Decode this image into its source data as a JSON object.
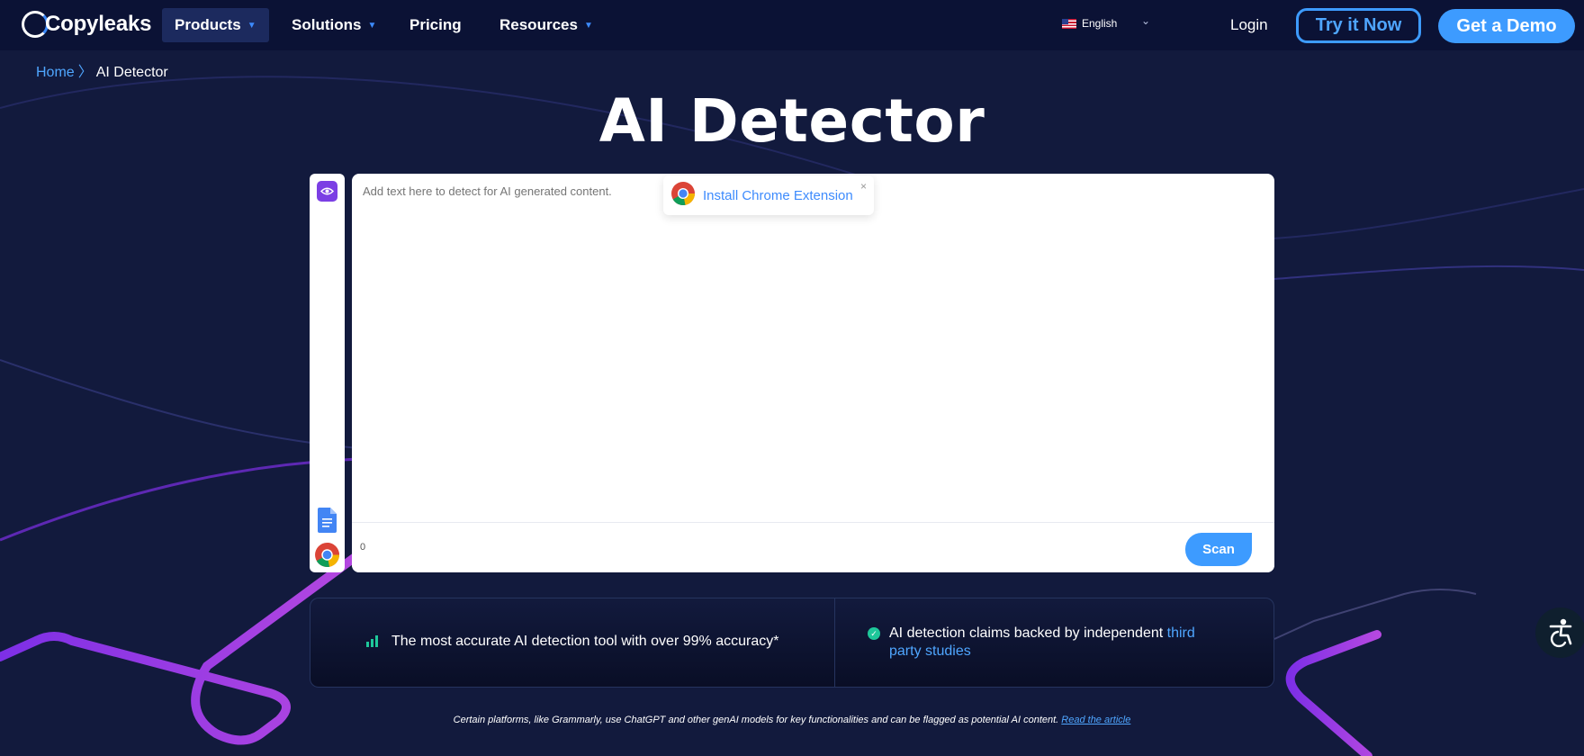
{
  "nav": {
    "logo_text": "Copyleaks",
    "logo_letter": "C",
    "items": [
      {
        "label": "Products",
        "has_caret": true,
        "active": true
      },
      {
        "label": "Solutions",
        "has_caret": true,
        "active": false
      },
      {
        "label": "Pricing",
        "has_caret": false,
        "active": false
      },
      {
        "label": "Resources",
        "has_caret": true,
        "active": false
      }
    ],
    "language": "English",
    "login": "Login",
    "try_label": "Try it Now",
    "demo_label": "Get a Demo"
  },
  "breadcrumb": {
    "home": "Home",
    "separator": "〉",
    "current": "AI Detector"
  },
  "page_title": "AI Detector",
  "editor": {
    "placeholder": "Add text here to detect for AI generated content.",
    "extension_popup": {
      "label": "Install Chrome Extension",
      "close": "×"
    },
    "word_count": "0",
    "scan_label": "Scan"
  },
  "claims": {
    "accuracy": "The most accurate AI detection tool with over 99% accuracy*",
    "backed_prefix": "AI detection claims backed by independent ",
    "backed_link": "third party studies"
  },
  "footnote": {
    "text": "Certain platforms, like Grammarly, use ChatGPT and other genAI models for key functionalities and can be flagged as potential AI content. ",
    "link": "Read the article"
  },
  "icons": {
    "eye": "eye-icon",
    "doc": "google-docs-icon",
    "chrome": "chrome-icon",
    "accessibility": "accessibility-icon"
  },
  "colors": {
    "background": "#121a3d",
    "nav": "#0b1235",
    "accent": "#3d9bff",
    "purple": "#7b3fe4",
    "check": "#1ec79a"
  }
}
